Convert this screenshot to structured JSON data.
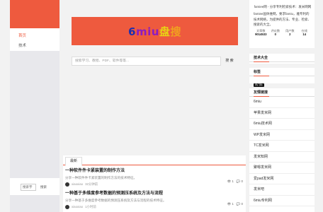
{
  "left_nav": {
    "items": [
      {
        "label": "首页",
        "active": true
      },
      {
        "label": "技术",
        "active": false
      }
    ],
    "search_placeholder": "搜索字",
    "search_button": "搜索"
  },
  "brand": {
    "logo_parts": [
      "6",
      "miu",
      "盘",
      "搜"
    ],
    "banner_color": "#ee5a3e"
  },
  "search": {
    "placeholder": "搜索学习、教程、PDF、软件等等...",
    "button": "搜 索"
  },
  "feed": {
    "tab": "最新",
    "items": [
      {
        "title": "一种软件件卡紧装置的制作方法",
        "summary": "分享一种软件件卡紧装置的制作方法的技术特征。",
        "author": "xiaoxiao",
        "time": "32分钟前",
        "likes": "1",
        "comments": "0"
      },
      {
        "title": "一种基于多维度参考数据的预测压系统及方法与流程",
        "summary": "分享一种基于多维度参考数据的预测压系统及方法与流程的技术特征。",
        "author": "xiaoxiao",
        "time": "1小时前",
        "likes": "1",
        "comments": "0"
      }
    ]
  },
  "site_info": {
    "desc1": "famiee网 - 分享专利检索技术：发米网网",
    "desc2": "famiee国体维网，要求famiu，雅专利的技术网络，为提供的方法、专业、检索、搜索的大全。",
    "stats": [
      {
        "label": "文章数",
        "value": "9014533"
      },
      {
        "label": "评论数",
        "value": "0"
      },
      {
        "label": "用户数",
        "value": "2"
      },
      {
        "label": "在线",
        "value": "14"
      }
    ]
  },
  "panels": {
    "tech_title": "技术大全",
    "tags_title": "标签",
    "tag": "热门标",
    "links_title": "友情链接",
    "links": [
      "6miu",
      "苹果发米网",
      "6miu技术网",
      "WP发米网",
      "TC发米网",
      "发米知网",
      "聚嗯发米网",
      "爱pad发米网",
      "发米吧",
      "6miu专利网"
    ]
  }
}
